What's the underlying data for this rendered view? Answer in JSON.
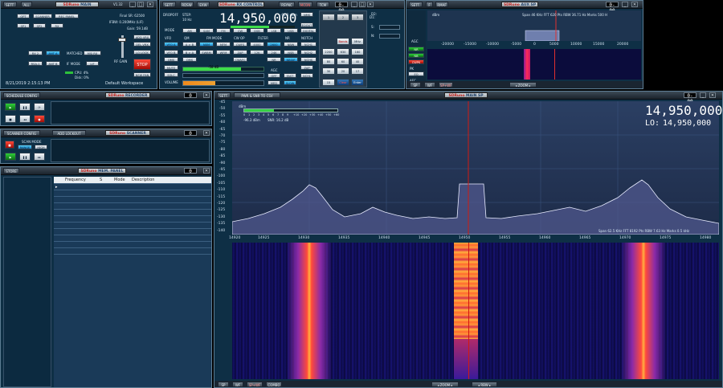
{
  "main": {
    "sett": "SETT.",
    "all": "ALL",
    "logo": "SDRuno",
    "main_label": "MAIN",
    "version": "V1.32",
    "buttons": [
      "OPT",
      "SCANNER",
      "REC PANEL",
      "SP1",
      "SP2",
      "RX",
      "RX 2",
      "ANT A",
      "RSA-1",
      "ANT B",
      "MATCHED",
      "MSI RX",
      "IF MODE",
      "LIF"
    ],
    "final_sr": "Final SR: 62500",
    "ifbw": "IFBW: 0.200MHz (LIF)",
    "gain": "Gain: 59.1dB",
    "rf_gain": "RF GAIN",
    "right_buttons": [
      "ADD VRX",
      "DEL VRX",
      "LO LOCK",
      "STOP",
      "NEW PAN"
    ],
    "cpu": "CPU: 4%",
    "cpu2": "Disk: 0%",
    "datetime": "8/21/2019 2:15:13 PM",
    "workspace": "Default Workspace"
  },
  "rx_control": {
    "sett": "SETT.",
    "rdsw": "RDSW",
    "exw": "EXW",
    "logo": "SDRuno",
    "title": "RX CONTROL",
    "rsync": "RSYNC",
    "mcon": "MCON",
    "tcm": "TCM",
    "step_label": "STEP:",
    "step_value": "10 Hz",
    "freq": "14,950,000",
    "smeter": "-95.3 dBm",
    "smeter2": "-58 dB",
    "mode_label": "MODE",
    "rows": [
      [
        "AM",
        "SAM",
        "FM",
        "CW",
        "DSB",
        "LSB",
        "USB",
        "DIGITAL"
      ],
      [
        "A > B",
        "NBM",
        "MFM",
        "CWFS",
        "4000",
        "2600",
        "NBW",
        "NCH1"
      ],
      [
        "B > A",
        "SWBM",
        "WFM",
        "ZAP",
        "12K",
        "24K",
        "NSB",
        "NCH2"
      ],
      [
        "QMS",
        "CWAFC",
        "NR",
        "NBGIF",
        "NCHS"
      ]
    ],
    "labels": [
      "VFO",
      "QM",
      "FM MODE",
      "CW OP",
      "FILTER",
      "NR",
      "NOTCH"
    ],
    "left_buttons": [
      "VFO A",
      "VFO B",
      "QMS",
      "MUTE",
      "SQLC",
      "VOLUME"
    ],
    "right_labels": [
      "AGC",
      "OFF",
      "FAST",
      "NCHL",
      "SLOW",
      "MED",
      "ZAP",
      "EQOUT"
    ]
  },
  "keypad": {
    "keys": [
      "1",
      "2",
      "3",
      "Bands",
      "MHz",
      "2200",
      "630",
      "160",
      "80",
      "60",
      "40",
      "30",
      "20",
      "17",
      "15",
      "Clear",
      "Enter",
      "12",
      "10"
    ],
    "rows": [
      "D1:",
      "D2:",
      "S:",
      "N:"
    ]
  },
  "aux_sp": {
    "sett": "SETT.",
    "f": "F",
    "rmaf": "RMAF",
    "logo": "SDRuno",
    "title": "AUX SP",
    "dbm": "dBm",
    "info": "Span 46 KHz   FFT 620 Pts   RBW 36.71 Hz   Marks 500 H",
    "xticks": [
      "-20000",
      "-15000",
      "-10000",
      "-5000",
      "0",
      "5000",
      "10000",
      "15000",
      "20000"
    ],
    "yticks": [
      "-30",
      "-60",
      "-90",
      "-120",
      "-150"
    ],
    "bottom": [
      "SP",
      "WF",
      "SP+WF",
      "ZOOM"
    ],
    "side": [
      "AGC",
      "NR",
      "NB",
      "CWPK",
      "PK",
      "EQ",
      "AFC",
      "MS+MK",
      "WIDE",
      "DCM"
    ]
  },
  "schedule": {
    "sett": "SCHEDULE CONFIG",
    "logo": "SDRuno",
    "title": "RECORDER"
  },
  "scanner": {
    "sett": "SCANNER CONFIG",
    "add": "ADD LOCKOUT",
    "logo": "SDRuno",
    "title": "SCANNER",
    "scan_mode": "SCAN MODE",
    "scan": "RANGE",
    "high": "HIGH"
  },
  "store": {
    "store": "STORE",
    "logo": "SDRuno",
    "title": "MEM. PANEL",
    "columns": [
      "Frequency",
      "S",
      "Mode",
      "Description"
    ]
  },
  "main_sp": {
    "pwr": "PWR & SNR TO CSV",
    "logo": "SDRuno",
    "title": "MAIN SP",
    "dbm": "dBm",
    "meter_scale": [
      "0",
      "1",
      "2",
      "3",
      "4",
      "5",
      "6",
      "7",
      "8",
      "9",
      "+10",
      "+20",
      "+30",
      "+40",
      "+50",
      "+60"
    ],
    "meter_value": "-96.3 dBm",
    "meter_snr": "SNR: 16.2 dB",
    "freq": "14,950,000",
    "lo_label": "LO:",
    "lo": "14,950,000",
    "yticks": [
      "-45",
      "-50",
      "-55",
      "-60",
      "-65",
      "-70",
      "-75",
      "-80",
      "-85",
      "-90",
      "-95",
      "-100",
      "-105",
      "-110",
      "-115",
      "-120",
      "-125",
      "-130",
      "-135",
      "-140"
    ],
    "xticks": [
      "14920",
      "14925",
      "14930",
      "14935",
      "14940",
      "14945",
      "14950",
      "14955",
      "14960",
      "14965",
      "14970",
      "14975",
      "14980"
    ],
    "info": "Span 62.5 KHz   FFT 8192 Pts   RBW 7.63 Hz   Marks 0.5 kHz",
    "bottom": [
      "SP",
      "WF",
      "SP+WF",
      "COMBO",
      "ZOOM",
      "RBW"
    ]
  },
  "colors": {
    "panel": "#0e2f45",
    "accent": "#33c7ff",
    "trace": "#e8ecff",
    "red": "#d21a10"
  }
}
